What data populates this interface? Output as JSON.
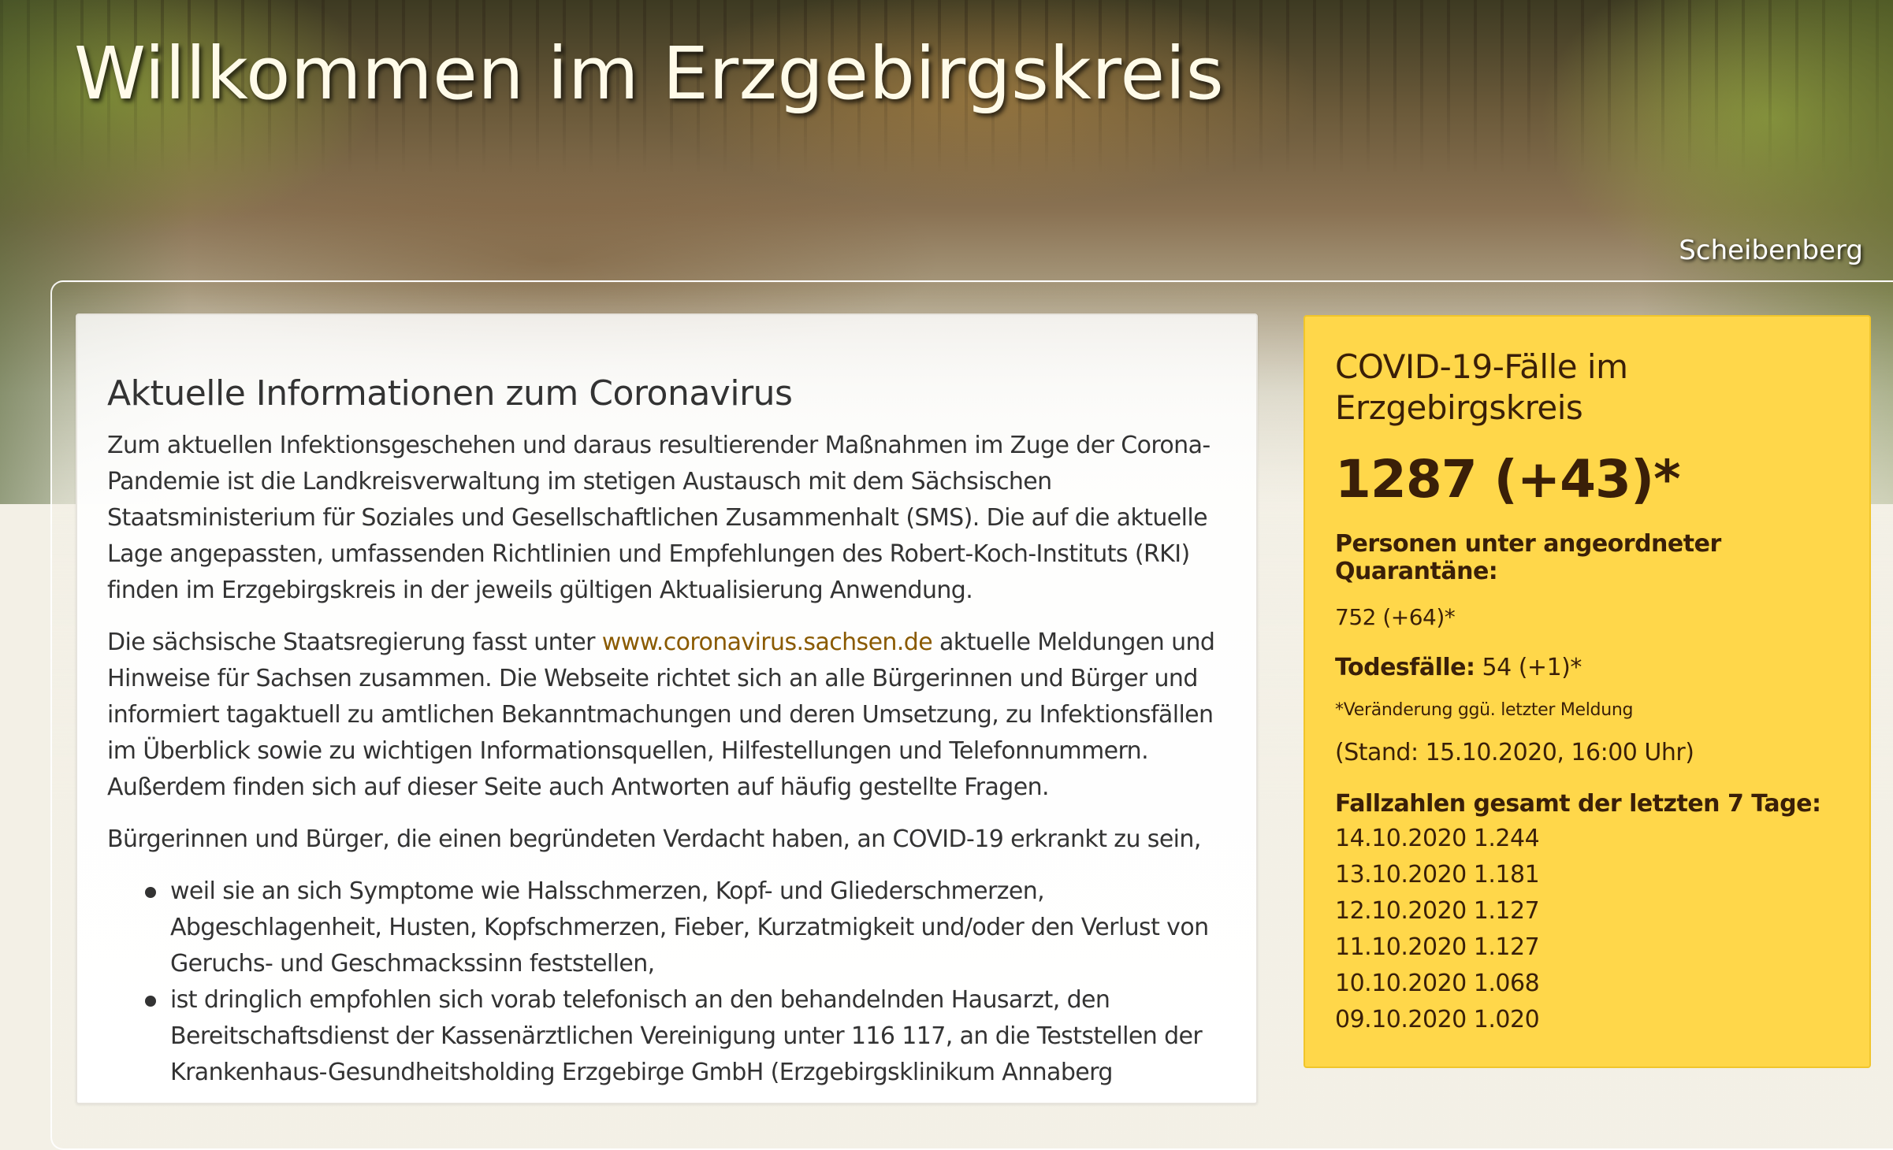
{
  "header": {
    "site_title": "Willkommen im Erzgebirgskreis",
    "photo_caption": "Scheibenberg"
  },
  "article": {
    "heading": "Aktuelle Informationen zum Coronavirus",
    "p1": "Zum aktuellen Infektionsgeschehen und daraus resultierender Maßnahmen im Zuge der Corona-Pandemie ist die Landkreisverwaltung im stetigen Austausch mit dem Sächsischen Staatsministerium für Soziales und Gesellschaftlichen Zusammenhalt (SMS). Die auf die aktuelle Lage angepassten, umfassenden Richtlinien und Empfehlungen des Robert-Koch-Instituts (RKI) finden im Erzgebirgskreis in der jeweils gültigen Aktualisierung Anwendung.",
    "p2_before": "Die sächsische Staatsregierung fasst unter ",
    "p2_link": "www.coronavirus.sachsen.de",
    "p2_after": " aktuelle Meldungen und Hinweise für Sachsen zusammen. Die Webseite richtet sich an alle Bürgerinnen und Bürger und informiert tagaktuell zu amtlichen Bekanntmachungen und deren Umsetzung, zu Infektionsfällen im Überblick sowie zu wichtigen Informationsquellen, Hilfestellungen und Telefonnummern. Außerdem finden sich auf dieser Seite auch Antworten auf häufig gestellte Fragen.",
    "p3": "Bürgerinnen und Bürger, die einen begründeten Verdacht haben, an COVID-19 erkrankt zu sein,",
    "bullets": [
      "weil sie an sich Symptome wie Halsschmerzen, Kopf- und Gliederschmerzen, Abgeschlagenheit, Husten, Kopfschmerzen, Fieber, Kurzatmigkeit und/oder den Verlust von Geruchs- und Geschmackssinn feststellen,",
      "ist dringlich empfohlen sich vorab telefonisch an den behandelnden Hausarzt, den Bereitschaftsdienst der Kassenärztlichen Vereinigung unter 116 117, an die Teststellen der Krankenhaus-Gesundheitsholding Erzgebirge GmbH (Erzgebirgsklinikum Annaberg"
    ]
  },
  "covid": {
    "heading": "COVID-19-Fälle im Erzgebirgskreis",
    "cases": "1287 (+43)*",
    "quarantine_label": "Personen unter angeordneter Quarantäne:",
    "quarantine_value": "752 (+64)*",
    "deaths_label": "Todesfälle:",
    "deaths_value": " 54 (+1)*",
    "note": "*Veränderung ggü. letzter Meldung",
    "stand": "(Stand: 15.10.2020, 16:00 Uhr)",
    "seven_days_label": "Fallzahlen gesamt der letzten 7 Tage:",
    "seven_days": [
      "14.10.2020 1.244",
      "13.10.2020 1.181",
      "12.10.2020 1.127",
      "11.10.2020 1.127",
      "10.10.2020 1.068",
      "09.10.2020 1.020"
    ]
  }
}
